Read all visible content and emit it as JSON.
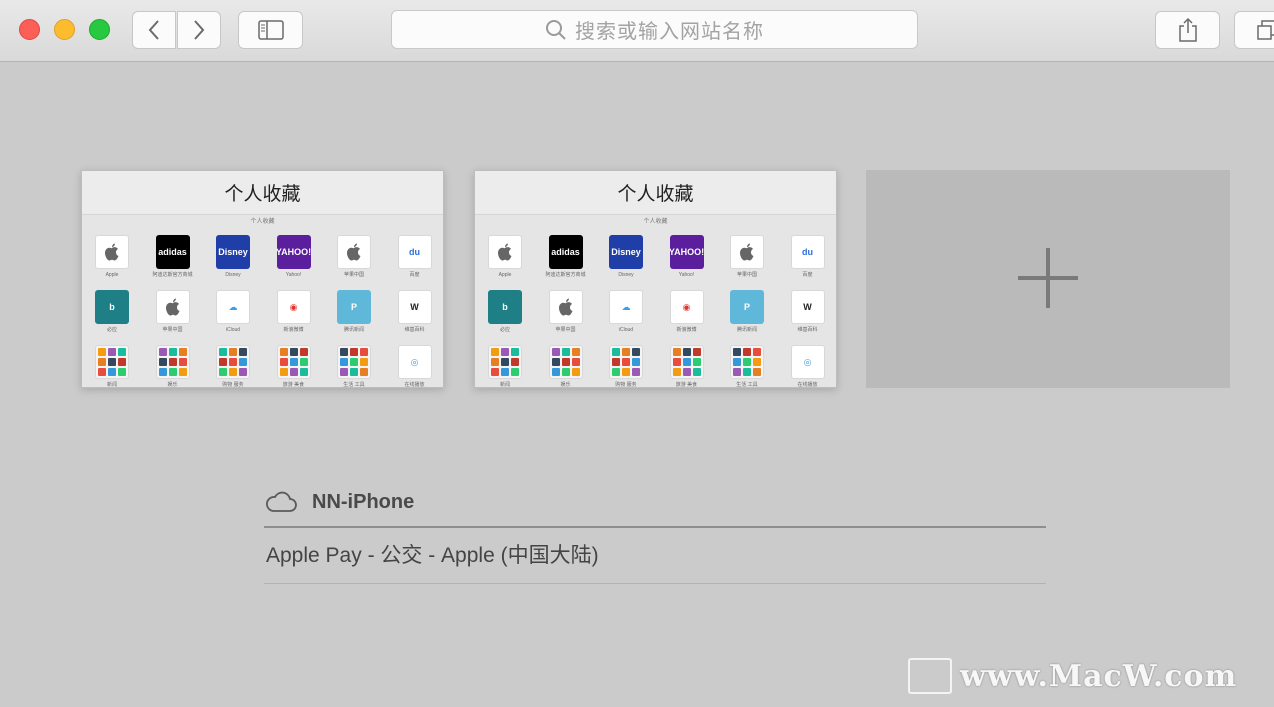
{
  "toolbar": {
    "search_placeholder": "搜索或输入网站名称"
  },
  "thumbnails": [
    {
      "title": "个人收藏",
      "subtitle": "个人收藏"
    },
    {
      "title": "个人收藏",
      "subtitle": "个人收藏"
    }
  ],
  "favorites": [
    {
      "label": "Apple",
      "icon": "apple-logo",
      "bg": "#ffffff",
      "fg": "#555555",
      "glyph": ""
    },
    {
      "label": "阿迪达斯官方商城",
      "icon": "adidas-logo",
      "bg": "#000000",
      "fg": "#ffffff",
      "glyph": "adidas"
    },
    {
      "label": "Disney",
      "icon": "disney-logo",
      "bg": "#1f3ea8",
      "fg": "#ffffff",
      "glyph": "Disney"
    },
    {
      "label": "Yahoo!",
      "icon": "yahoo-logo",
      "bg": "#5b1f9e",
      "fg": "#ffffff",
      "glyph": "YAHOO!"
    },
    {
      "label": "苹果中国",
      "icon": "apple-logo",
      "bg": "#ffffff",
      "fg": "#555555",
      "glyph": ""
    },
    {
      "label": "百度",
      "icon": "baidu-logo",
      "bg": "#ffffff",
      "fg": "#2e6fd8",
      "glyph": "du"
    },
    {
      "label": "必应",
      "icon": "bing-logo",
      "bg": "#1e7f86",
      "fg": "#ffffff",
      "glyph": "b"
    },
    {
      "label": "苹果中国",
      "icon": "apple-logo",
      "bg": "#ffffff",
      "fg": "#555555",
      "glyph": ""
    },
    {
      "label": "iCloud",
      "icon": "icloud-logo",
      "bg": "#ffffff",
      "fg": "#3a9ee8",
      "glyph": "☁"
    },
    {
      "label": "新浪微博",
      "icon": "weibo-logo",
      "bg": "#ffffff",
      "fg": "#e0332c",
      "glyph": "◉"
    },
    {
      "label": "腾讯新闻",
      "icon": "pp-logo",
      "bg": "#5fb8d9",
      "fg": "#ffffff",
      "glyph": "P"
    },
    {
      "label": "维基百科",
      "icon": "wikipedia-logo",
      "bg": "#ffffff",
      "fg": "#222222",
      "glyph": "W"
    },
    {
      "label": "新闻",
      "icon": "folder-icon",
      "bg": "#f4f4f4",
      "fg": "#888888",
      "glyph": ""
    },
    {
      "label": "娱乐",
      "icon": "folder-icon",
      "bg": "#f4f4f4",
      "fg": "#888888",
      "glyph": ""
    },
    {
      "label": "购物 服务",
      "icon": "folder-icon",
      "bg": "#f4f4f4",
      "fg": "#888888",
      "glyph": ""
    },
    {
      "label": "旅游 美食",
      "icon": "folder-icon",
      "bg": "#f4f4f4",
      "fg": "#888888",
      "glyph": ""
    },
    {
      "label": "生活 工具",
      "icon": "folder-icon",
      "bg": "#f4f4f4",
      "fg": "#888888",
      "glyph": ""
    },
    {
      "label": "在线播放",
      "icon": "app-icon",
      "bg": "#ffffff",
      "fg": "#3a9ee8",
      "glyph": "◎"
    }
  ],
  "icloud": {
    "device_name": "NN-iPhone",
    "tabs": [
      "Apple Pay - 公交 - Apple (中国大陆)"
    ]
  },
  "watermark": {
    "text": "www.MacW.com"
  }
}
